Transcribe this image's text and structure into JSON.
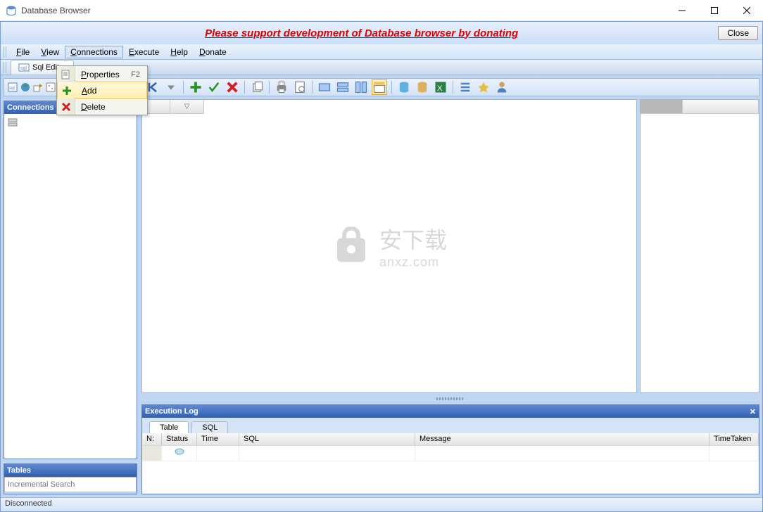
{
  "window": {
    "title": "Database Browser"
  },
  "donate": {
    "message": "Please support development of Database browser by donating",
    "close": "Close"
  },
  "menu": {
    "file": "File",
    "view": "View",
    "connections": "Connections",
    "execute": "Execute",
    "help": "Help",
    "donate": "Donate"
  },
  "dropdown": {
    "properties": {
      "label": "Properties",
      "shortcut": "F2"
    },
    "add": {
      "label": "Add"
    },
    "delete": {
      "label": "Delete"
    }
  },
  "tabs": {
    "sql_editor": "Sql Editor"
  },
  "panels": {
    "connections": "Connections",
    "tables": "Tables",
    "incremental_placeholder": "Incremental Search"
  },
  "exec_log": {
    "title": "Execution Log",
    "tabs": {
      "table": "Table",
      "sql": "SQL"
    },
    "columns": {
      "n": "N:",
      "status": "Status",
      "time": "Time",
      "sql": "SQL",
      "message": "Message",
      "timetaken": "TimeTaken"
    }
  },
  "status": {
    "text": "Disconnected"
  },
  "watermark": {
    "main": "安下载",
    "sub": "anxz.com"
  }
}
